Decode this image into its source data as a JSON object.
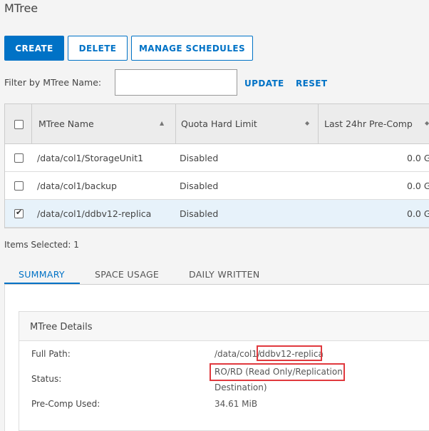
{
  "page": {
    "title": "MTree"
  },
  "toolbar": {
    "create": "CREATE",
    "delete": "DELETE",
    "manage_schedules": "MANAGE SCHEDULES"
  },
  "filter": {
    "label": "Filter by MTree Name:",
    "value": "",
    "update": "UPDATE",
    "reset": "RESET"
  },
  "grid": {
    "columns": [
      "MTree Name",
      "Quota Hard Limit",
      "Last 24hr Pre-Comp"
    ],
    "rows": [
      {
        "name": "/data/col1/StorageUnit1",
        "quota": "Disabled",
        "precomp": "0.0 G",
        "checked": false
      },
      {
        "name": "/data/col1/backup",
        "quota": "Disabled",
        "precomp": "0.0 G",
        "checked": false
      },
      {
        "name": "/data/col1/ddbv12-replica",
        "quota": "Disabled",
        "precomp": "0.0 G",
        "checked": true
      }
    ]
  },
  "status": {
    "items_selected": "Items Selected: 1"
  },
  "tabs": [
    "SUMMARY",
    "SPACE USAGE",
    "DAILY WRITTEN"
  ],
  "details": {
    "title": "MTree Details",
    "full_path_label": "Full Path:",
    "full_path_prefix": "/data/col1/",
    "full_path_name": "ddbv12-replica",
    "status_label": "Status:",
    "status_line1": "RO/RD (Read Only/Replication",
    "status_line2": "Destination)",
    "precomp_label": "Pre-Comp Used:",
    "precomp_value": "34.61 MiB"
  },
  "colors": {
    "accent": "#0072c6",
    "highlight": "#e0393e",
    "selected_row": "#e7f2fa"
  }
}
